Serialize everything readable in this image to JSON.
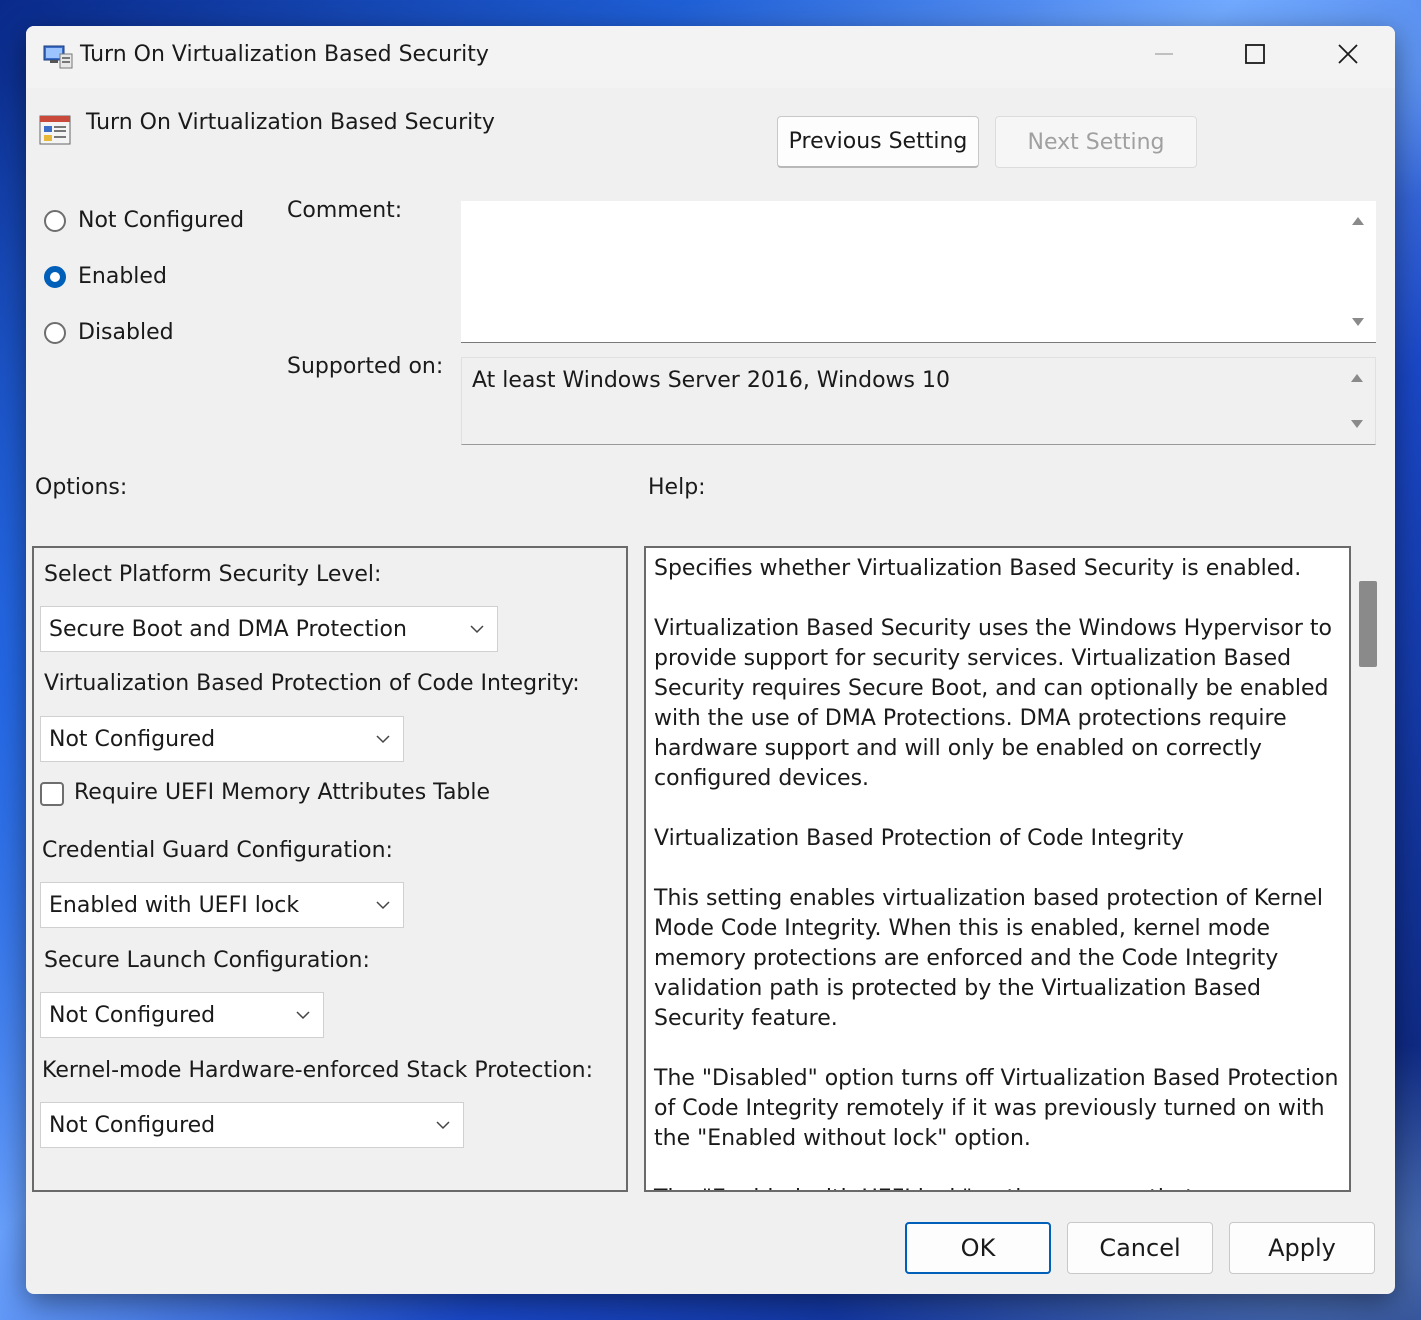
{
  "window": {
    "title": "Turn On Virtualization Based Security"
  },
  "header": {
    "policy_name": "Turn On Virtualization Based Security",
    "previous_setting_label": "Previous Setting",
    "next_setting_label": "Next Setting"
  },
  "state": {
    "options": [
      {
        "label": "Not Configured",
        "selected": false
      },
      {
        "label": "Enabled",
        "selected": true
      },
      {
        "label": "Disabled",
        "selected": false
      }
    ]
  },
  "comment": {
    "label": "Comment:",
    "value": ""
  },
  "supported": {
    "label": "Supported on:",
    "value": "At least Windows Server 2016, Windows 10"
  },
  "options_section": {
    "label": "Options:",
    "platform_security_label": "Select Platform Security Level:",
    "platform_security_value": "Secure Boot and DMA Protection",
    "code_integrity_label": "Virtualization Based Protection of Code Integrity:",
    "code_integrity_value": "Not Configured",
    "uefi_table_label": "Require UEFI Memory Attributes Table",
    "uefi_table_checked": false,
    "credential_guard_label": "Credential Guard Configuration:",
    "credential_guard_value": "Enabled with UEFI lock",
    "secure_launch_label": "Secure Launch Configuration:",
    "secure_launch_value": "Not Configured",
    "stack_protection_label": "Kernel-mode Hardware-enforced Stack Protection:",
    "stack_protection_value": "Not Configured"
  },
  "help_section": {
    "label": "Help:",
    "paragraphs": [
      "Specifies whether Virtualization Based Security is enabled.",
      "Virtualization Based Security uses the Windows Hypervisor to provide support for security services. Virtualization Based Security requires Secure Boot, and can optionally be enabled with the use of DMA Protections. DMA protections require hardware support and will only be enabled on correctly configured devices.",
      "Virtualization Based Protection of Code Integrity",
      "This setting enables virtualization based protection of Kernel Mode Code Integrity. When this is enabled, kernel mode memory protections are enforced and the Code Integrity validation path is protected by the Virtualization Based Security feature.",
      "The \"Disabled\" option turns off Virtualization Based Protection of Code Integrity remotely if it was previously turned on with the \"Enabled without lock\" option.",
      "The \"Enabled with UEFI lock\" option ensures that Virtualization Based Protection of Code Integrity cannot be disabled remotely."
    ]
  },
  "footer": {
    "ok_label": "OK",
    "cancel_label": "Cancel",
    "apply_label": "Apply"
  },
  "colors": {
    "accent": "#005fb8",
    "window_bg": "#f0f0f0"
  }
}
